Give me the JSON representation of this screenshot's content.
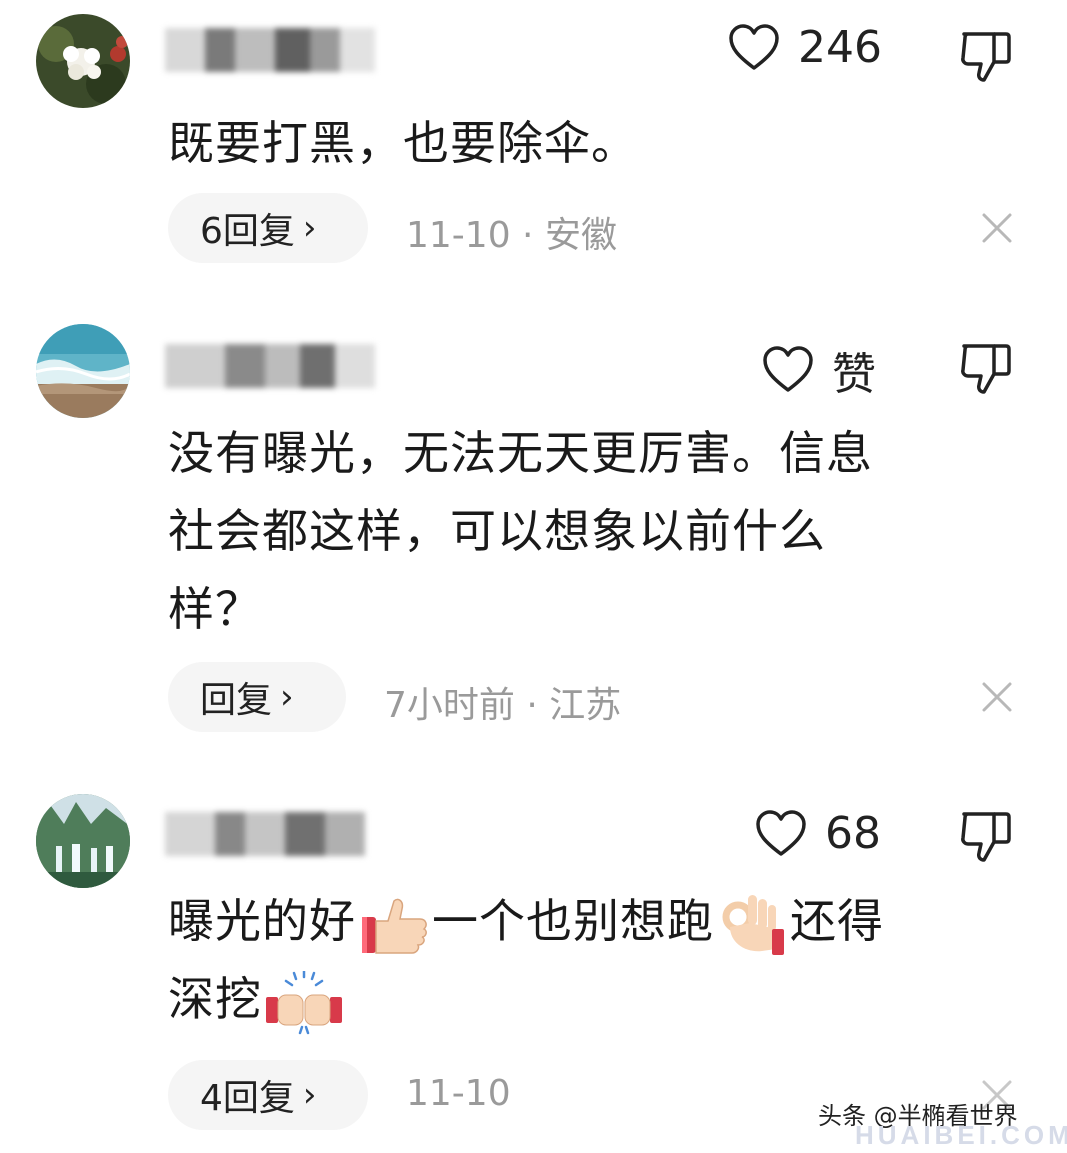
{
  "comments": [
    {
      "like_count": "246",
      "text": "既要打黑，也要除伞。",
      "reply_label": "6回复",
      "meta": "11-10 · 安徽"
    },
    {
      "like_count": "赞",
      "text_lines": [
        "没有曝光，无法无天更厉害。信息",
        "社会都这样，可以想象以前什么",
        "样？"
      ],
      "reply_label": "回复",
      "meta": "7小时前 · 江苏"
    },
    {
      "like_count": "68",
      "text_parts": [
        "曝光的好",
        "一个也别想跑",
        "还得",
        "深挖"
      ],
      "reply_label": "4回复",
      "meta": "11-10"
    }
  ],
  "icons": {
    "like": "heart-outline-icon",
    "dislike": "thumbs-down-outline-icon",
    "close": "close-icon",
    "chevron": "chevron-right-icon"
  },
  "watermark": {
    "text": "头条 @半椭看世界",
    "logo": "HUAIBEI.COM"
  }
}
